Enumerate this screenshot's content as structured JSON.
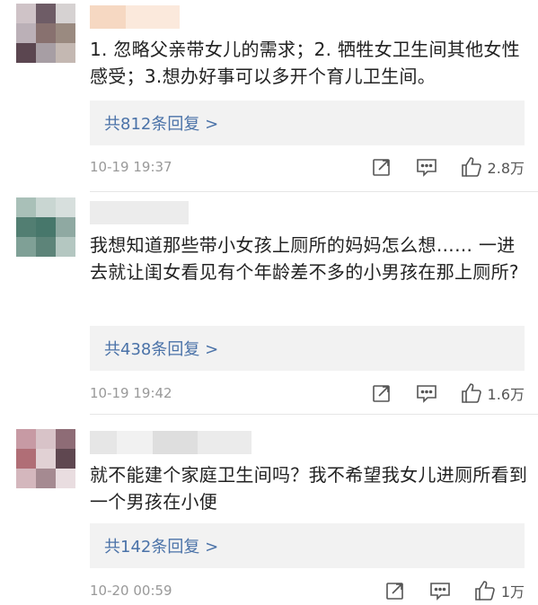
{
  "comments": [
    {
      "text": "1. 忽略父亲带女儿的需求；2. 牺牲女卫生间其他女性感受；3.想办好事可以多开个育儿卫生间。",
      "replies_label": "共812条回复 >",
      "time": "10-19 19:37",
      "likes": "2.8万"
    },
    {
      "text": "我想知道那些带小女孩上厕所的妈妈怎么想…… 一进去就让闺女看见有个年龄差不多的小男孩在那上厕所?",
      "replies_label": "共438条回复 >",
      "time": "10-19 19:42",
      "likes": "1.6万"
    },
    {
      "text": "就不能建个家庭卫生间吗？我不希望我女儿进厕所看到一个男孩在小便",
      "replies_label": "共142条回复 >",
      "time": "10-20 00:59",
      "likes": "1万"
    }
  ],
  "icons": {
    "share": "share-icon",
    "comment": "comment-icon",
    "like": "thumbs-up-icon"
  },
  "colors": {
    "link": "#4a72a8",
    "text": "#222222",
    "meta": "#999999",
    "reply_bg": "#f2f2f2"
  }
}
